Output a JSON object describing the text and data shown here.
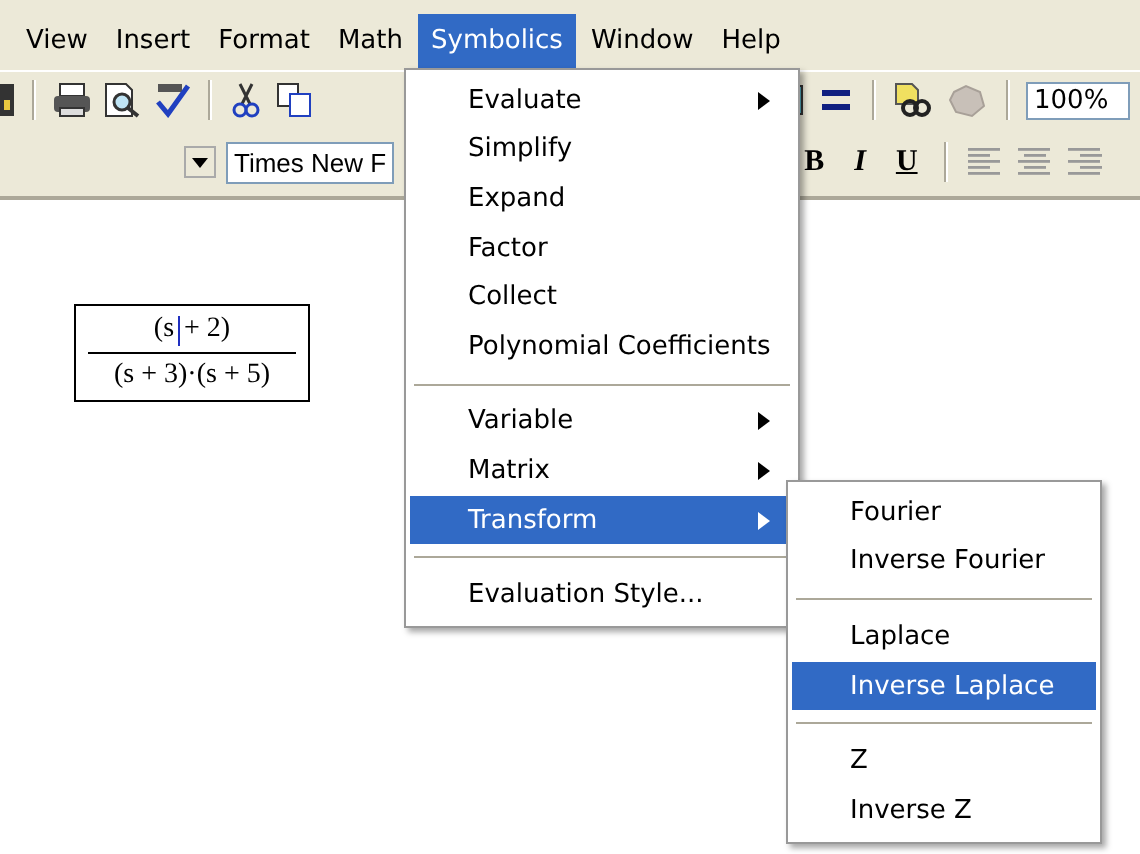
{
  "menubar": [
    {
      "label": "View",
      "selected": false
    },
    {
      "label": "Insert",
      "selected": false
    },
    {
      "label": "Format",
      "selected": false
    },
    {
      "label": "Math",
      "selected": false
    },
    {
      "label": "Symbolics",
      "selected": true
    },
    {
      "label": "Window",
      "selected": false
    },
    {
      "label": "Help",
      "selected": false
    }
  ],
  "toolbar": {
    "zoom": "100%"
  },
  "format_bar": {
    "font": "Times New F",
    "buttons": [
      "B",
      "I",
      "U"
    ]
  },
  "equation": {
    "numerator_before_cursor": "(s",
    "numerator_after_cursor": "+ 2)",
    "denominator": "(s + 3)·(s + 5)"
  },
  "symbolics_menu": [
    {
      "kind": "item",
      "label": "Evaluate",
      "submenu": true,
      "selected": false
    },
    {
      "kind": "item",
      "label": "Simplify",
      "submenu": false,
      "selected": false
    },
    {
      "kind": "item",
      "label": "Expand",
      "submenu": false,
      "selected": false
    },
    {
      "kind": "item",
      "label": "Factor",
      "submenu": false,
      "selected": false
    },
    {
      "kind": "item",
      "label": "Collect",
      "submenu": false,
      "selected": false
    },
    {
      "kind": "item",
      "label": "Polynomial Coefficients",
      "submenu": false,
      "selected": false
    },
    {
      "kind": "separator"
    },
    {
      "kind": "item",
      "label": "Variable",
      "submenu": true,
      "selected": false
    },
    {
      "kind": "item",
      "label": "Matrix",
      "submenu": true,
      "selected": false
    },
    {
      "kind": "item",
      "label": "Transform",
      "submenu": true,
      "selected": true
    },
    {
      "kind": "separator"
    },
    {
      "kind": "item",
      "label": "Evaluation Style...",
      "submenu": false,
      "selected": false
    }
  ],
  "transform_menu": [
    {
      "kind": "item",
      "label": "Fourier",
      "selected": false
    },
    {
      "kind": "item",
      "label": "Inverse Fourier",
      "selected": false
    },
    {
      "kind": "separator"
    },
    {
      "kind": "item",
      "label": "Laplace",
      "selected": false
    },
    {
      "kind": "item",
      "label": "Inverse Laplace",
      "selected": true
    },
    {
      "kind": "separator"
    },
    {
      "kind": "item",
      "label": "Z",
      "selected": false
    },
    {
      "kind": "item",
      "label": "Inverse Z",
      "selected": false
    }
  ]
}
